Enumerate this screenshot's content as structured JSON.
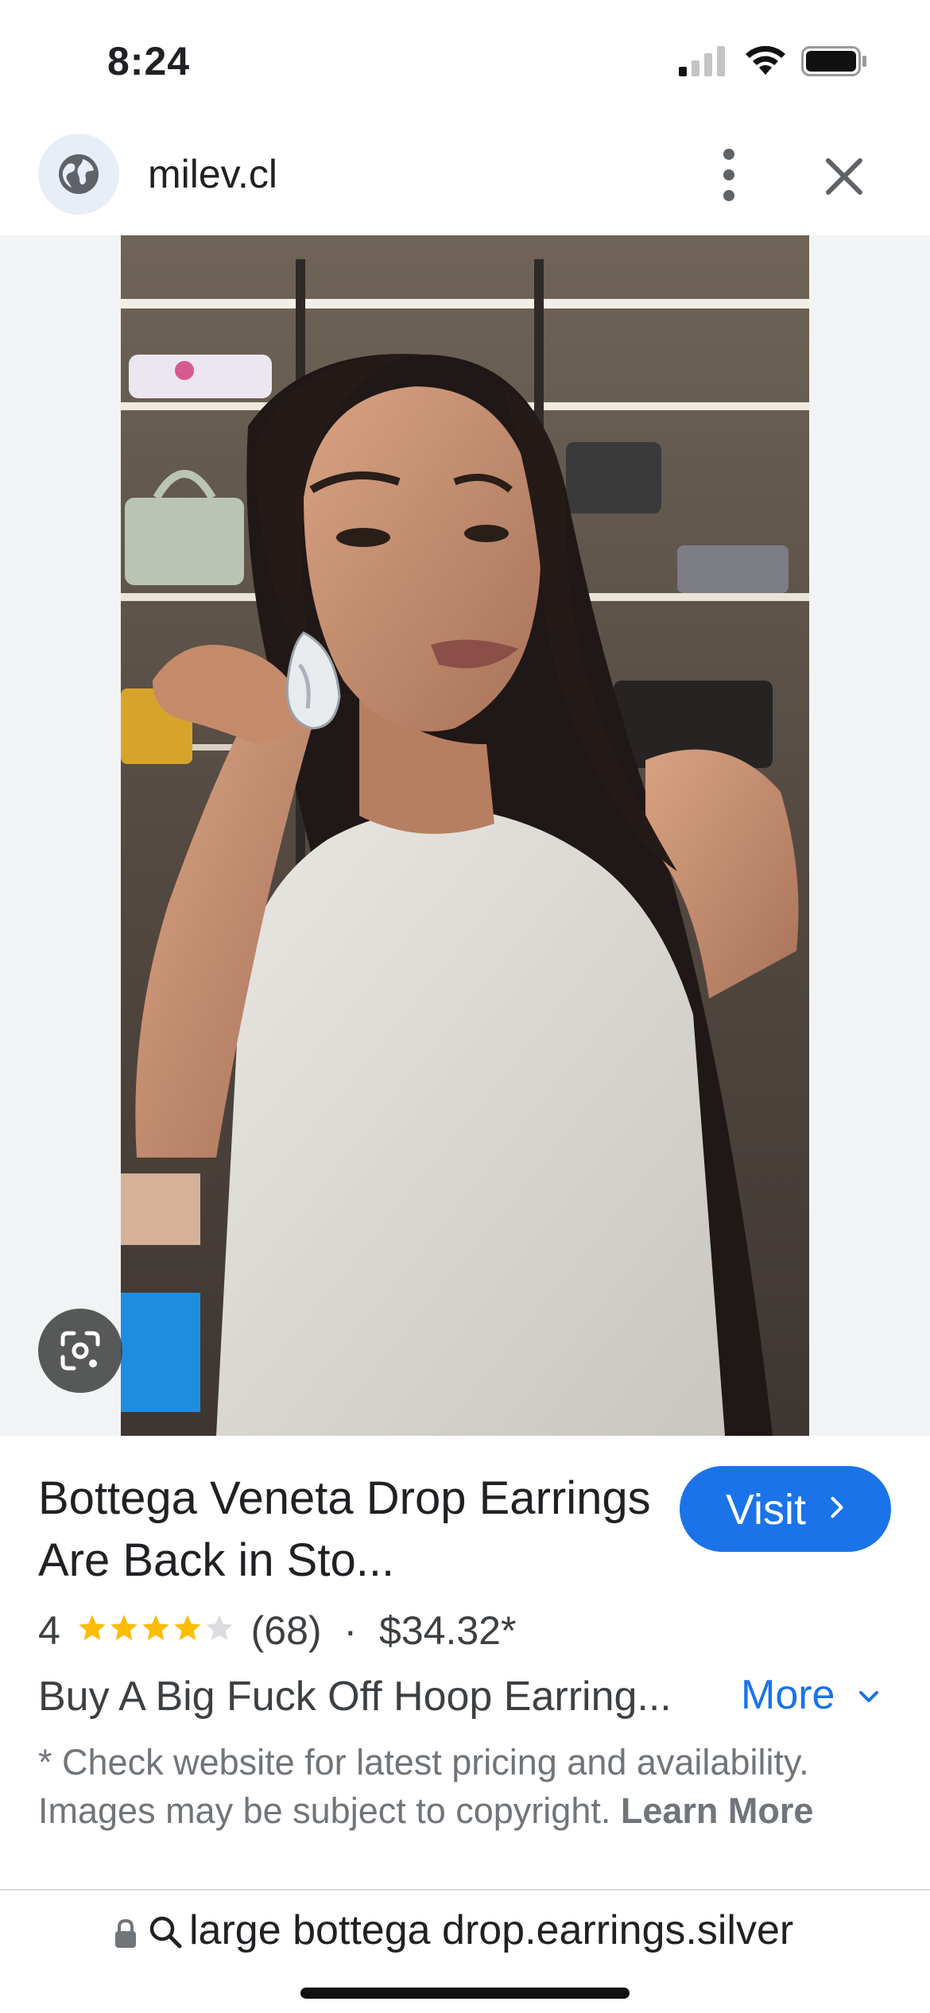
{
  "status_bar": {
    "time": "8:24"
  },
  "top_bar": {
    "site": "milev.cl",
    "icons": [
      "globe-icon",
      "more-vert-icon",
      "close-icon"
    ]
  },
  "image": {
    "lens_icon": "google-lens-icon"
  },
  "result": {
    "title": "Bottega Veneta Drop Earrings Are Back in Sto...",
    "visit_label": "Visit",
    "rating": "4",
    "stars": 4,
    "max_stars": 5,
    "review_count": "(68)",
    "separator": "·",
    "price": "$34.32*",
    "description": "Buy A Big Fuck Off Hoop Earring...",
    "more_label": "More",
    "disclaimer": "* Check website for latest pricing and availability. Images may be subject to copyright.",
    "learn_more": "Learn More"
  },
  "url_bar": {
    "query": "large bottega drop.earrings.silver"
  },
  "colors": {
    "accent": "#1a73e8",
    "star": "#fbbc04",
    "star_empty": "#dadce0",
    "secondary_text": "#70757a"
  }
}
